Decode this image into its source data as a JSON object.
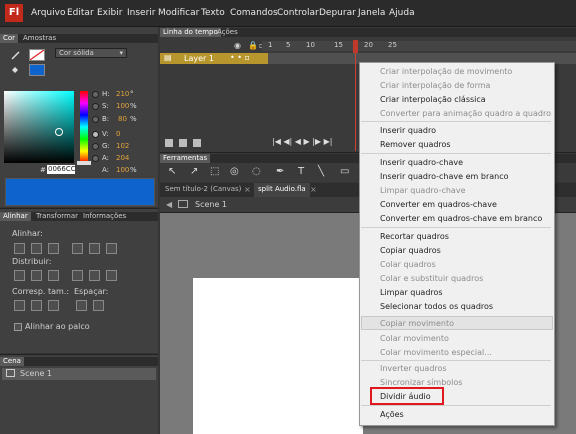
{
  "menubar": {
    "logo": "Fl",
    "items": [
      "Arquivo",
      "Editar",
      "Exibir",
      "Inserir",
      "Modificar",
      "Texto",
      "Comandos",
      "Controlar",
      "Depurar",
      "Janela",
      "Ajuda"
    ]
  },
  "color_panel": {
    "tabs": [
      "Cor",
      "Amostras"
    ],
    "fill_type": "Cor sólida",
    "rows": [
      {
        "label": "H:",
        "value": "210",
        "unit": "°"
      },
      {
        "label": "S:",
        "value": "100",
        "unit": "%"
      },
      {
        "label": "B:",
        "value": "80",
        "unit": "%"
      },
      {
        "label": "V:",
        "value": "0",
        "unit": ""
      },
      {
        "label": "G:",
        "value": "102",
        "unit": ""
      },
      {
        "label": "A:",
        "value": "204",
        "unit": ""
      },
      {
        "label": "A:",
        "value": "100",
        "unit": "%"
      }
    ],
    "hex_label": "#",
    "hex": "0066CC",
    "preview_color": "#0f63cc"
  },
  "align_panel": {
    "tabs": [
      "Alinhar",
      "Transformar",
      "Informações"
    ],
    "sections": [
      "Alinhar:",
      "Distribuir:",
      "Corresp. tam.:",
      "Espaçar:"
    ],
    "checkbox_label": "Alinhar ao palco"
  },
  "scene_panel": {
    "title": "Cena",
    "scene": "Scene 1"
  },
  "timeline": {
    "tabs": [
      "Linha do tempo",
      "Ações"
    ],
    "ruler": [
      "1",
      "5",
      "10",
      "15",
      "20",
      "25"
    ],
    "layer_name": "Layer 1"
  },
  "tools": {
    "title": "Ferramentas"
  },
  "doc_tabs": [
    "Sem título-2 (Canvas)",
    "split Audio.fla"
  ],
  "edit_bar": {
    "scene": "Scene 1"
  },
  "context_menu": {
    "items": [
      {
        "label": "Criar interpolação de movimento",
        "enabled": false
      },
      {
        "label": "Criar interpolação de forma",
        "enabled": false
      },
      {
        "label": "Criar interpolação clássica",
        "enabled": true
      },
      {
        "label": "Converter para animação quadro a quadro",
        "enabled": false
      },
      {
        "label": "Inserir quadro",
        "enabled": true
      },
      {
        "label": "Remover quadros",
        "enabled": true
      },
      {
        "label": "Inserir quadro-chave",
        "enabled": true
      },
      {
        "label": "Inserir quadro-chave em branco",
        "enabled": true
      },
      {
        "label": "Limpar quadro-chave",
        "enabled": false
      },
      {
        "label": "Converter em quadros-chave",
        "enabled": true
      },
      {
        "label": "Converter em quadros-chave em branco",
        "enabled": true
      },
      {
        "label": "Recortar quadros",
        "enabled": true
      },
      {
        "label": "Copiar quadros",
        "enabled": true
      },
      {
        "label": "Colar quadros",
        "enabled": false
      },
      {
        "label": "Colar e substituir quadros",
        "enabled": false
      },
      {
        "label": "Limpar quadros",
        "enabled": true
      },
      {
        "label": "Selecionar todos os quadros",
        "enabled": true
      },
      {
        "label": "Copiar movimento",
        "enabled": false
      },
      {
        "label": "Colar movimento",
        "enabled": false
      },
      {
        "label": "Colar movimento especial...",
        "enabled": false
      },
      {
        "label": "Inverter quadros",
        "enabled": false
      },
      {
        "label": "Sincronizar símbolos",
        "enabled": false
      },
      {
        "label": "Dividir áudio",
        "enabled": true
      },
      {
        "label": "Ações",
        "enabled": true
      }
    ]
  },
  "colors": {
    "highlight_box": "#e0171e",
    "playhead": "#c0392b",
    "layer": "#b8962e"
  }
}
